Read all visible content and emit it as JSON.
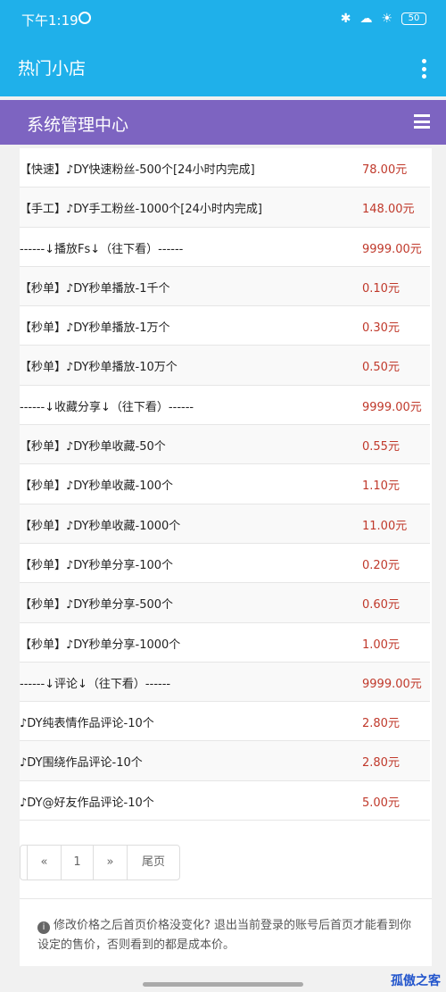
{
  "status_bar": {
    "time": "下午1:19",
    "battery": "50"
  },
  "app_bar": {
    "title": "热门小店"
  },
  "header": {
    "title": "系统管理中心"
  },
  "products": [
    {
      "name": "【快速】♪DY快速粉丝-500个[24小时内完成]",
      "price": "78.00元"
    },
    {
      "name": "【手工】♪DY手工粉丝-1000个[24小时内完成]",
      "price": "148.00元"
    },
    {
      "name": "------↓播放Fs↓（往下看）------",
      "price": "9999.00元"
    },
    {
      "name": "【秒单】♪DY秒单播放-1千个",
      "price": "0.10元"
    },
    {
      "name": "【秒单】♪DY秒单播放-1万个",
      "price": "0.30元"
    },
    {
      "name": "【秒单】♪DY秒单播放-10万个",
      "price": "0.50元"
    },
    {
      "name": "------↓收藏分享↓（往下看）------",
      "price": "9999.00元"
    },
    {
      "name": "【秒单】♪DY秒单收藏-50个",
      "price": "0.55元"
    },
    {
      "name": "【秒单】♪DY秒单收藏-100个",
      "price": "1.10元"
    },
    {
      "name": "【秒单】♪DY秒单收藏-1000个",
      "price": "11.00元"
    },
    {
      "name": "【秒单】♪DY秒单分享-100个",
      "price": "0.20元"
    },
    {
      "name": "【秒单】♪DY秒单分享-500个",
      "price": "0.60元"
    },
    {
      "name": "【秒单】♪DY秒单分享-1000个",
      "price": "1.00元"
    },
    {
      "name": "------↓评论↓（往下看）------",
      "price": "9999.00元"
    },
    {
      "name": "♪DY纯表情作品评论-10个",
      "price": "2.80元"
    },
    {
      "name": "♪DY围绕作品评论-10个",
      "price": "2.80元"
    },
    {
      "name": "♪DY@好友作品评论-10个",
      "price": "5.00元"
    }
  ],
  "pagination": {
    "prev": "«",
    "page": "1",
    "next": "»",
    "last": "尾页"
  },
  "note": {
    "text": "修改价格之后首页价格没变化? 退出当前登录的账号后首页才能看到你设定的售价，否则看到的都是成本价。"
  },
  "watermark": "孤傲之客",
  "colors": {
    "status_bar": "#1fb0ea",
    "header": "#7d64c1",
    "price": "#c0392b"
  }
}
